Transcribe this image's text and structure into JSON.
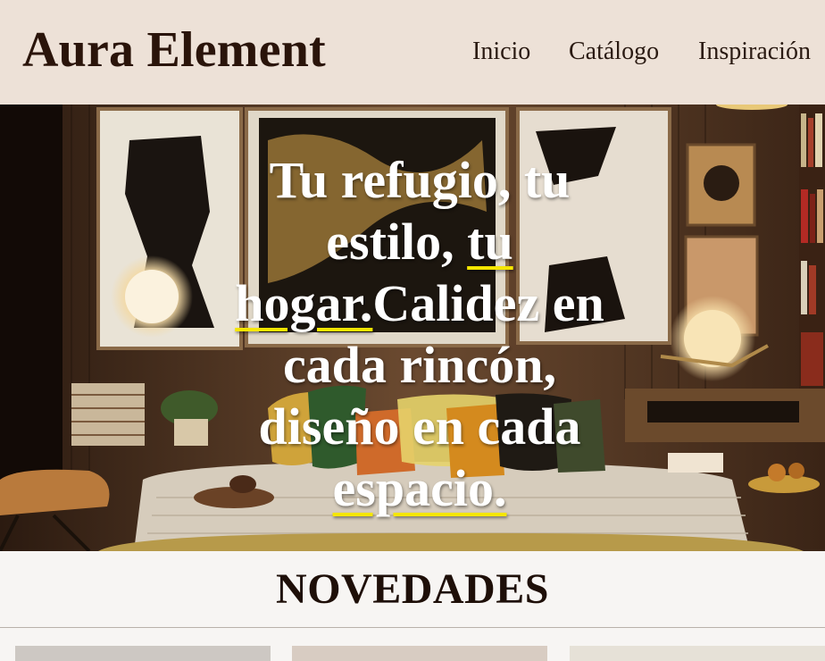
{
  "header": {
    "brand": "Aura Element",
    "nav": [
      {
        "label": "Inicio"
      },
      {
        "label": "Catálogo"
      },
      {
        "label": "Inspiración"
      }
    ]
  },
  "hero": {
    "line1": "Tu refugio, tu",
    "line2a": "estilo, ",
    "line2_link": "tu",
    "line3_link": "hogar.",
    "line3b": "Calidez en",
    "line4": "cada rincón,",
    "line5": "diseño en cada",
    "line6_link": "espacio.",
    "underline_color": "#f5e600"
  },
  "section": {
    "title": "NOVEDADES"
  }
}
